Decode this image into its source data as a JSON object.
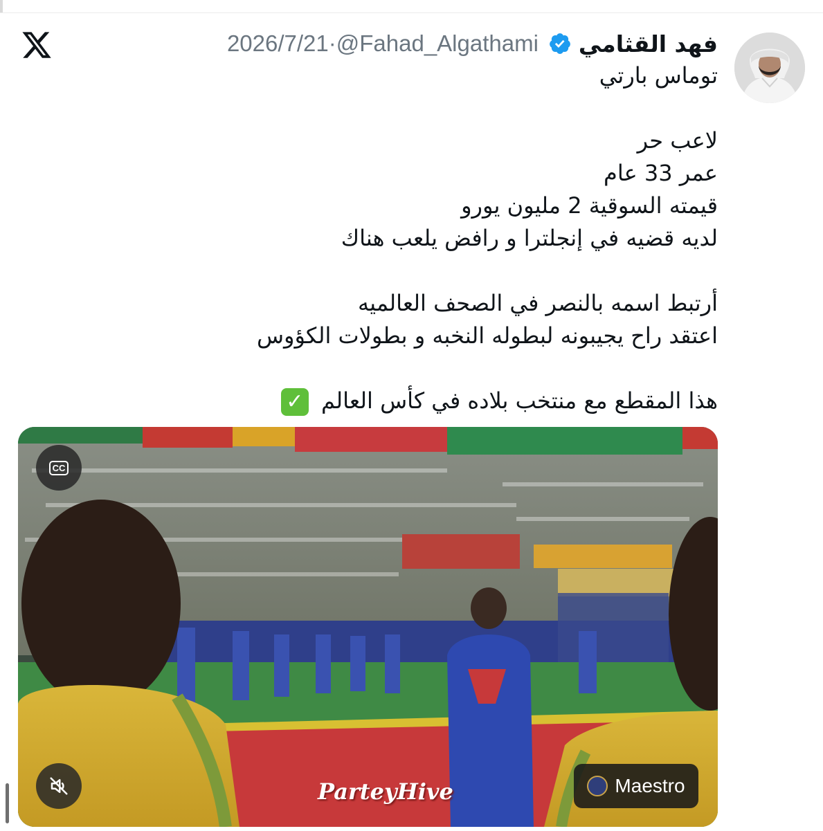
{
  "tweet": {
    "author": {
      "display_name": "فهد القثامي",
      "handle": "@Fahad_Algathami",
      "verified": true
    },
    "date": "2026/7/21",
    "separator": "·",
    "lines": [
      "توماس بارتي",
      "",
      "لاعب حر",
      "عمر 33 عام",
      "قيمته السوقية 2 مليون يورو",
      "لديه قضيه في إنجلترا و رافض يلعب هناك",
      "",
      "أرتبط اسمه بالنصر في الصحف العالميه",
      "اعتقد راح يجيبونه لبطوله النخبه و بطولات الكؤوس",
      ""
    ],
    "last_line": "هذا المقطع مع منتخب بلاده في كأس العالم",
    "last_line_emoji": "✓"
  },
  "video": {
    "cc_label": "CC",
    "watermark": "ParteyHive",
    "sponsor_badge": "Maestro",
    "mute_icon": "speaker-muted-icon",
    "cc_icon": "closed-captions-icon"
  },
  "colors": {
    "verified_blue": "#1d9bf0",
    "meta_gray": "#6b7680",
    "text": "#0f1419"
  },
  "icons": {
    "platform": "x-logo-icon",
    "verified": "verified-badge-icon"
  }
}
